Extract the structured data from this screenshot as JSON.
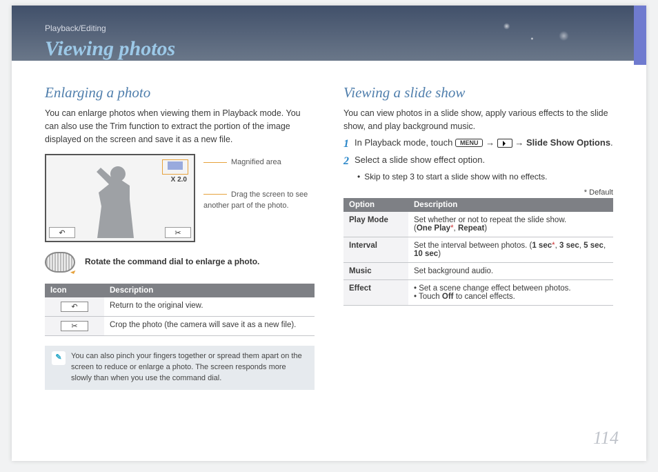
{
  "header": {
    "breadcrumb": "Playback/Editing",
    "title": "Viewing photos"
  },
  "left": {
    "h2": "Enlarging a photo",
    "intro": "You can enlarge photos when viewing them in Playback mode. You can also use the Trim function to extract the portion of the image displayed on the screen and save it as a new file.",
    "zoom_label": "X 2.0",
    "annot_magnified": "Magnified area",
    "annot_drag": "Drag the screen to see another part of the photo.",
    "dial_text": "Rotate the command dial to enlarge a photo.",
    "icon_table": {
      "headers": [
        "Icon",
        "Description"
      ],
      "rows": [
        {
          "glyph": "↶",
          "desc": "Return to the original view."
        },
        {
          "glyph": "✂",
          "desc": "Crop the photo (the camera will save it as a new file)."
        }
      ]
    },
    "note": "You can also pinch your fingers together or spread them apart on the screen to reduce or enlarge a photo. The screen responds more slowly than when you use the command dial."
  },
  "right": {
    "h2": "Viewing a slide show",
    "intro": "You can view photos in a slide show, apply various effects to the slide show, and play background music.",
    "step1_pre": "In Playback mode, touch ",
    "step1_menu": "MENU",
    "step1_arrow": " → ",
    "step1_post": "Slide Show Options",
    "step2": "Select a slide show effect option.",
    "sub_bullet": "Skip to step 3 to start a slide show with no effects.",
    "default_note": "* Default",
    "option_table": {
      "headers": [
        "Option",
        "Description"
      ],
      "rows": [
        {
          "label": "Play Mode",
          "lines": [
            "Set whether or not to repeat the slide show.",
            "(<b>One Play</b><span class='star'>*</span>, <b>Repeat</b>)"
          ]
        },
        {
          "label": "Interval",
          "lines": [
            "Set the interval between photos. (<b>1 sec</b><span class='star'>*</span>, <b>3 sec</b>, <b>5 sec</b>, <b>10 sec</b>)"
          ]
        },
        {
          "label": "Music",
          "lines": [
            "Set background audio."
          ]
        },
        {
          "label": "Effect",
          "lines": [
            "<ul class='inset'><li>Set a scene change effect between photos.</li><li>Touch <b>Off</b> to cancel effects.</li></ul>"
          ]
        }
      ]
    }
  },
  "page_number": "114"
}
